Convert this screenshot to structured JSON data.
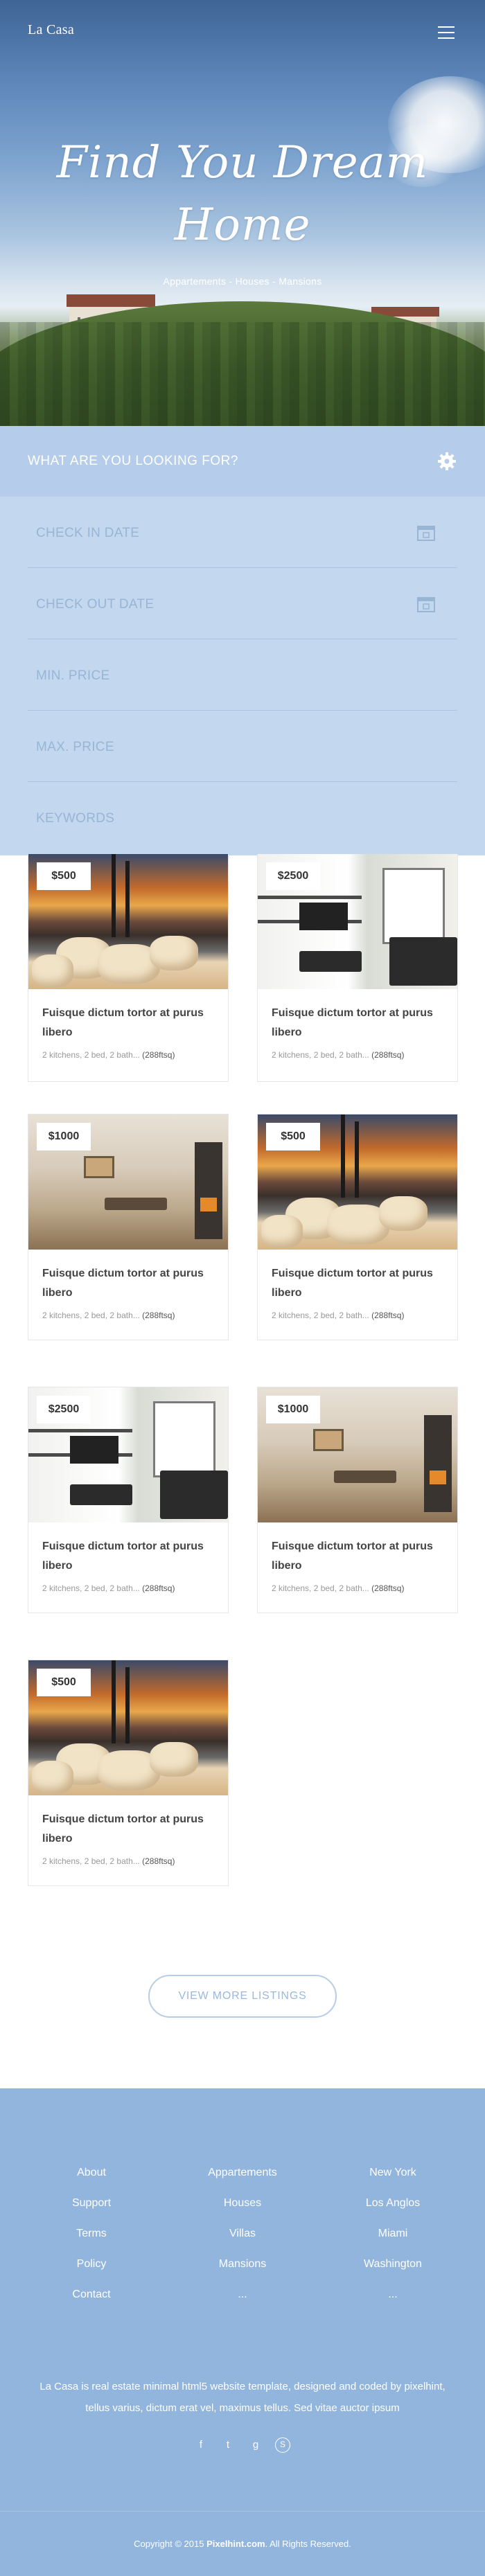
{
  "header": {
    "brand": "La Casa",
    "menu_icon": "hamburger-menu-icon"
  },
  "hero": {
    "title_line1": "Find You Dream",
    "title_line2": "Home",
    "subtitle": "Appartements - Houses - Mansions"
  },
  "search": {
    "heading": "WHAT ARE YOU LOOKING FOR?",
    "settings_icon": "gear-icon",
    "fields": [
      {
        "placeholder": "CHECK IN DATE",
        "icon": "calendar-icon"
      },
      {
        "placeholder": "CHECK OUT DATE",
        "icon": "calendar-icon"
      },
      {
        "placeholder": "MIN. PRICE"
      },
      {
        "placeholder": "MAX. PRICE"
      },
      {
        "placeholder": "KEYWORDS"
      }
    ]
  },
  "listings": [
    {
      "price": "$500",
      "title": "Fuisque dictum tortor at purus libero",
      "meta": "2 kitchens, 2 bed, 2 bath...",
      "area": "(288ftsq)",
      "image": "pool-terrace"
    },
    {
      "price": "$2500",
      "title": "Fuisque dictum tortor at purus libero",
      "meta": "2 kitchens, 2 bed, 2 bath...",
      "area": "(288ftsq)",
      "image": "living-room"
    },
    {
      "price": "$1000",
      "title": "Fuisque dictum tortor at purus libero",
      "meta": "2 kitchens, 2 bed, 2 bath...",
      "area": "(288ftsq)",
      "image": "dining-room"
    },
    {
      "price": "$500",
      "title": "Fuisque dictum tortor at purus libero",
      "meta": "2 kitchens, 2 bed, 2 bath...",
      "area": "(288ftsq)",
      "image": "pool-terrace"
    },
    {
      "price": "$2500",
      "title": "Fuisque dictum tortor at purus libero",
      "meta": "2 kitchens, 2 bed, 2 bath...",
      "area": "(288ftsq)",
      "image": "living-room"
    },
    {
      "price": "$1000",
      "title": "Fuisque dictum tortor at purus libero",
      "meta": "2 kitchens, 2 bed, 2 bath...",
      "area": "(288ftsq)",
      "image": "dining-room"
    },
    {
      "price": "$500",
      "title": "Fuisque dictum tortor at purus libero",
      "meta": "2 kitchens, 2 bed, 2 bath...",
      "area": "(288ftsq)",
      "image": "pool-terrace"
    }
  ],
  "more_button": "VIEW MORE LISTINGS",
  "footer": {
    "columns": [
      [
        "About",
        "Support",
        "Terms",
        "Policy",
        "Contact"
      ],
      [
        "Appartements",
        "Houses",
        "Villas",
        "Mansions",
        "..."
      ],
      [
        "New York",
        "Los Anglos",
        "Miami",
        "Washington",
        "..."
      ]
    ],
    "description": "La Casa is real estate minimal html5 website template, designed and coded by pixelhint, tellus varius, dictum erat vel, maximus tellus. Sed vitae auctor ipsum",
    "social": [
      {
        "icon": "facebook-icon",
        "glyph": "f"
      },
      {
        "icon": "twitter-icon",
        "glyph": "t"
      },
      {
        "icon": "google-plus-icon",
        "glyph": "g"
      },
      {
        "icon": "skype-icon",
        "glyph": "S"
      }
    ],
    "copyright_prefix": "Copyright © 2015 ",
    "copyright_brand": "Pixelhint.com",
    "copyright_suffix": ". All Rights Reserved."
  },
  "colors": {
    "accent": "#92b5de",
    "search_panel": "#c3d8ee",
    "search_head": "#b5cdea"
  }
}
